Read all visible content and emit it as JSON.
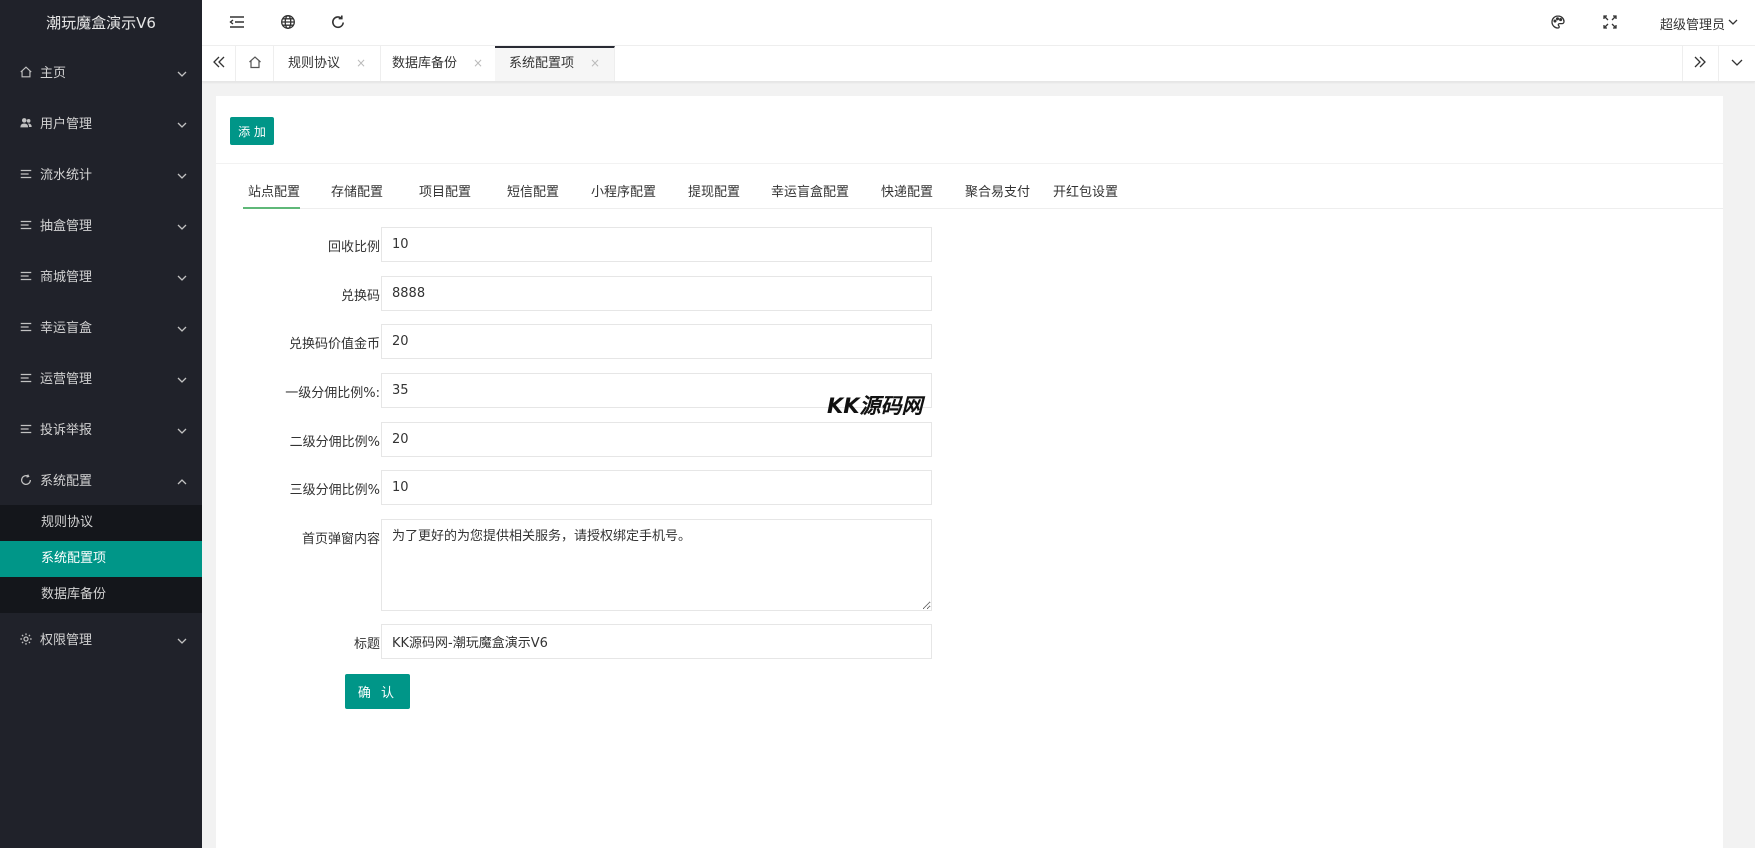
{
  "app": {
    "title": "潮玩魔盒演示V6"
  },
  "sidebar": {
    "items": [
      {
        "label": "主页",
        "icon": "home-icon"
      },
      {
        "label": "用户管理",
        "icon": "users-icon"
      },
      {
        "label": "流水统计",
        "icon": "list-icon"
      },
      {
        "label": "抽盒管理",
        "icon": "list-icon"
      },
      {
        "label": "商城管理",
        "icon": "list-icon"
      },
      {
        "label": "幸运盲盒",
        "icon": "list-icon"
      },
      {
        "label": "运营管理",
        "icon": "list-icon"
      },
      {
        "label": "投诉举报",
        "icon": "list-icon"
      },
      {
        "label": "系统配置",
        "icon": "sync-icon",
        "expanded": true
      },
      {
        "label": "权限管理",
        "icon": "gear-icon"
      }
    ],
    "subitems": [
      {
        "label": "规则协议",
        "active": false
      },
      {
        "label": "系统配置项",
        "active": true
      },
      {
        "label": "数据库备份",
        "active": false
      }
    ]
  },
  "header": {
    "user_label": "超级管理员",
    "icons": [
      "menu-collapse-icon",
      "globe-icon",
      "refresh-icon",
      "theme-icon",
      "fullscreen-icon"
    ]
  },
  "tabs": {
    "items": [
      {
        "label": "规则协议",
        "close": "×"
      },
      {
        "label": "数据库备份",
        "close": "×"
      },
      {
        "label": "系统配置项",
        "close": "×",
        "active": true
      }
    ]
  },
  "toolbar": {
    "add_label": "添 加"
  },
  "config_tabs": [
    "站点配置",
    "存储配置",
    "项目配置",
    "短信配置",
    "小程序配置",
    "提现配置",
    "幸运盲盒配置",
    "快递配置",
    "聚合易支付",
    "开红包设置"
  ],
  "form": {
    "fields": [
      {
        "label": "回收比例",
        "value": "10"
      },
      {
        "label": "兑换码",
        "value": "8888"
      },
      {
        "label": "兑换码价值金币",
        "value": "20"
      },
      {
        "label": "一级分佣比例%:",
        "value": "35"
      },
      {
        "label": "二级分佣比例%",
        "value": "20"
      },
      {
        "label": "三级分佣比例%",
        "value": "10"
      }
    ],
    "popup": {
      "label": "首页弹窗内容",
      "value": "为了更好的为您提供相关服务，请授权绑定手机号。"
    },
    "title": {
      "label": "标题",
      "value": "KK源码网-潮玩魔盒演示V6"
    },
    "submit_label": "确 认"
  },
  "watermark": "KK源码网",
  "colors": {
    "accent": "#009688",
    "sidebar_bg": "#20222a",
    "tab_underline": "#5fb878"
  }
}
